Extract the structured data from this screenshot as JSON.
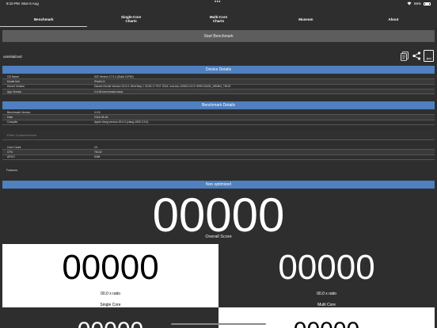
{
  "status_bar": {
    "time": "9:10 PM",
    "date": "Mon 5 Aug",
    "dots": "•••",
    "wifi": "wifi-icon",
    "battery_percent": "66%"
  },
  "tabs": [
    "Benchmark",
    "Single-Core\nCharts",
    "Multi-Core\nCharts",
    "Museum",
    "About"
  ],
  "start_button": "Start Benchmark",
  "status": "uninitialized",
  "device_details": {
    "title": "Device Details",
    "rows": [
      {
        "key": "OS Name",
        "value": "iOS Version 17.5.1 (Build 21F90)"
      },
      {
        "key": "Model Info",
        "value": "iPad14,5"
      },
      {
        "key": "Kernel Version",
        "value": "Darwin Kernel Version 23.5.0: Wed May 1 20:25:17 PDT 2024; root:xnu-10063.122.3~5/RELEASE_ARM64_T8132"
      },
      {
        "key": "App Version",
        "value": "0.6.48-benchmark-basic"
      }
    ]
  },
  "benchmark_details": {
    "title": "Benchmark Details",
    "rows": [
      {
        "key": "Benchmark Version",
        "value": "0.0.5"
      },
      {
        "key": "Date",
        "value": "2024-08-05"
      },
      {
        "key": "Compiler",
        "value": "Apple clang version 15.0.0 (clang-1500.3.9.4)"
      }
    ]
  },
  "comment_placeholder": "Enter Comment here",
  "cpu_rows": [
    {
      "key": "Core Count",
      "value": "10"
    },
    {
      "key": "CPU",
      "value": "T8132"
    },
    {
      "key": "ARCH",
      "value": "64bit"
    }
  ],
  "features_label": "Features",
  "non_optimized": "Non optimized",
  "overall": {
    "score": "00000",
    "label": "Overall Score"
  },
  "single_core": {
    "score": "00000",
    "ratio": "00.0 x ratio",
    "label": "Single Core"
  },
  "multi_core": {
    "score": "00000",
    "ratio": "00.0 x ratio",
    "label": "Multi Core"
  },
  "bottom_left": {
    "score": "00000"
  },
  "bottom_right": {
    "score": "00000"
  },
  "icons": {
    "clipboard": "clipboard-icon",
    "share": "share-icon",
    "json": "json-file-icon"
  },
  "json_label": ".json",
  "colors": {
    "accent": "#4f80bf",
    "background": "#2e2e2e",
    "button": "#5d5d5d"
  }
}
